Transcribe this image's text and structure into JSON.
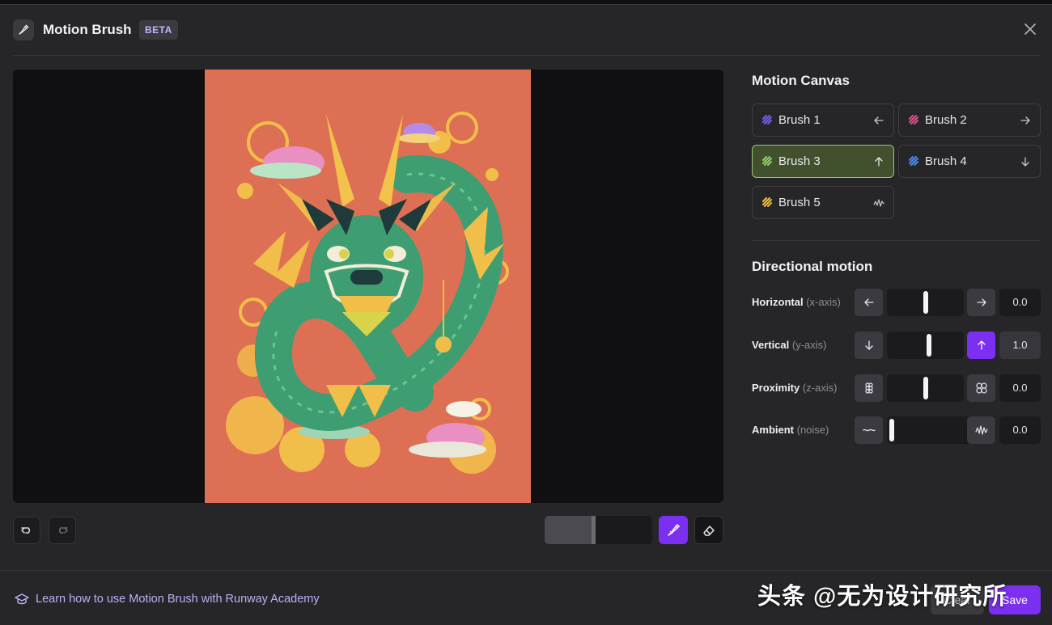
{
  "header": {
    "title": "Motion Brush",
    "badge": "BETA"
  },
  "panel": {
    "canvas_title": "Motion Canvas",
    "brushes": [
      {
        "label": "Brush 1",
        "color": "#7a5cf0",
        "direction": "left-arrow-icon"
      },
      {
        "label": "Brush 2",
        "color": "#e0518f",
        "direction": "right-arrow-icon"
      },
      {
        "label": "Brush 3",
        "color": "#8fd06a",
        "direction": "up-arrow-icon",
        "active": true
      },
      {
        "label": "Brush 4",
        "color": "#4a8ef0",
        "direction": "down-arrow-icon"
      },
      {
        "label": "Brush 5",
        "color": "#f0c03a",
        "direction": "noise-wave-icon"
      }
    ],
    "motion_title": "Directional motion",
    "motion": {
      "horizontal": {
        "label": "Horizontal",
        "axis": "(x-axis)",
        "value": "0.0",
        "level": 0.5
      },
      "vertical": {
        "label": "Vertical",
        "axis": "(y-axis)",
        "value": "1.0",
        "level": 0.55
      },
      "proximity": {
        "label": "Proximity",
        "axis": "(z-axis)",
        "value": "0.0",
        "level": 0.5
      },
      "ambient": {
        "label": "Ambient",
        "axis": "(noise)",
        "value": "0.0",
        "level": 0.0
      }
    }
  },
  "tools": {
    "brush_size_level": 0.47
  },
  "footer": {
    "link_text": "Learn how to use Motion Brush with Runway Academy",
    "cancel_label": "Clear",
    "save_label": "Save",
    "watermark": "头条 @无为设计研究所"
  },
  "colors": {
    "accent": "#7b2ff0",
    "active_brush_bg": "#41512e",
    "active_brush_border": "#9cc47a"
  }
}
